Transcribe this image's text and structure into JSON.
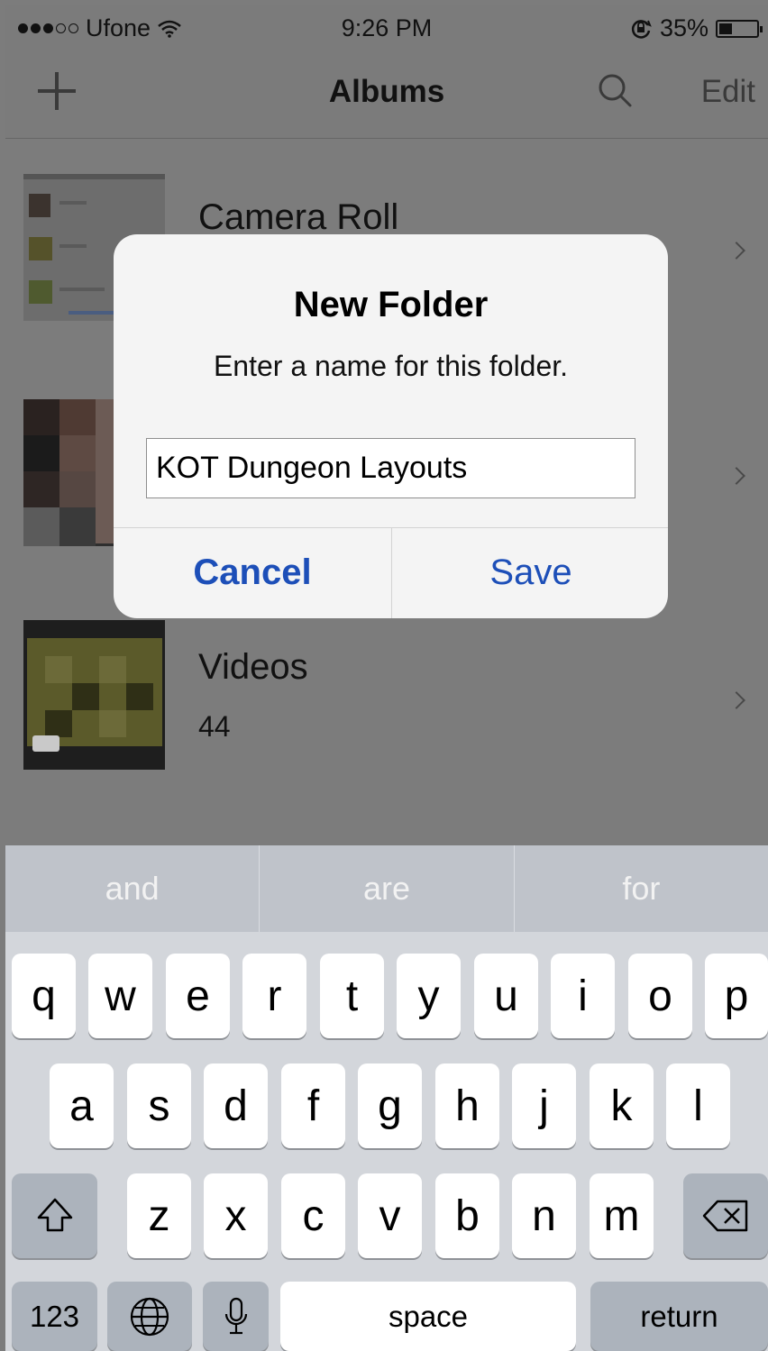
{
  "status": {
    "carrier": "Ufone",
    "time": "9:26 PM",
    "battery_percent": "35%",
    "battery_level": 0.35,
    "signal_bars": 3,
    "signal_total": 5
  },
  "navbar": {
    "add_icon": "plus-icon",
    "title": "Albums",
    "search_icon": "search-icon",
    "edit_label": "Edit"
  },
  "albums": [
    {
      "name": "Camera Roll",
      "count": ""
    },
    {
      "name": "",
      "count": ""
    },
    {
      "name": "Videos",
      "count": "44"
    }
  ],
  "alert": {
    "title": "New Folder",
    "message": "Enter a name for this folder.",
    "input_value": "KOT Dungeon Layouts",
    "cancel_label": "Cancel",
    "save_label": "Save"
  },
  "suggestions": [
    "and",
    "are",
    "for"
  ],
  "keyboard": {
    "row1": [
      "q",
      "w",
      "e",
      "r",
      "t",
      "y",
      "u",
      "i",
      "o",
      "p"
    ],
    "row2": [
      "a",
      "s",
      "d",
      "f",
      "g",
      "h",
      "j",
      "k",
      "l"
    ],
    "row3": [
      "z",
      "x",
      "c",
      "v",
      "b",
      "n",
      "m"
    ],
    "numbers_label": "123",
    "space_label": "space",
    "return_label": "return",
    "shift_icon": "shift-icon",
    "delete_icon": "delete-icon",
    "globe_icon": "globe-icon",
    "mic_icon": "microphone-icon"
  }
}
